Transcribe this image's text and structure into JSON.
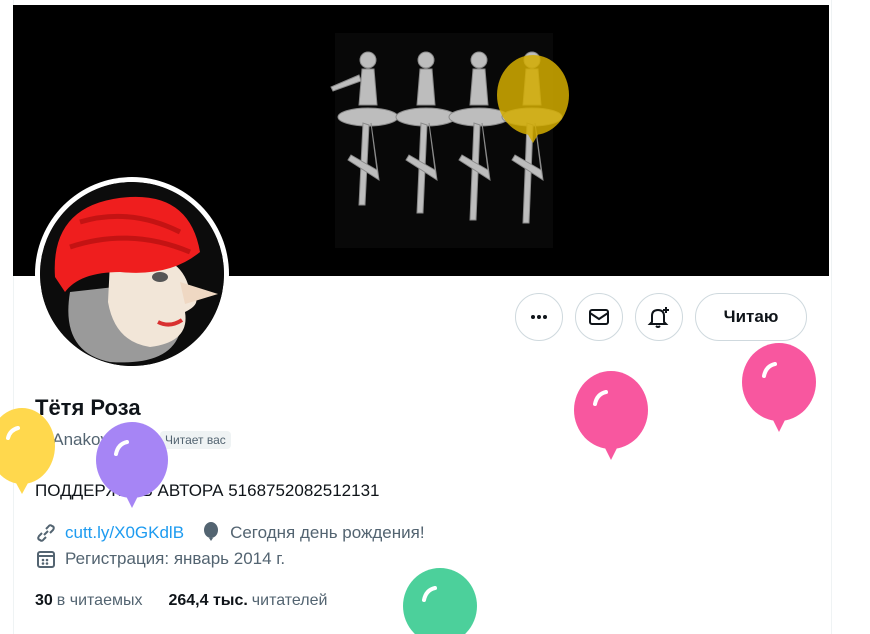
{
  "profile": {
    "display_name": "Тётя Роза",
    "handle": "@Anakoyher",
    "follows_you_badge": "Читает вас",
    "bio": "ПОДДЕРЖАТЬ АВТОРА 5168752082512131",
    "link_text": "cutt.ly/X0GKdlB",
    "birthday_text": "Сегодня день рождения!",
    "joined_text": "Регистрация: январь 2014 г."
  },
  "actions": {
    "follow_label": "Читаю",
    "more_icon": "more-icon",
    "message_icon": "envelope-icon",
    "notify_icon": "bell-plus-icon"
  },
  "stats": {
    "following_count": "30",
    "following_label": "в читаемых",
    "followers_count": "264,4 тыс.",
    "followers_label": "читателей"
  },
  "colors": {
    "link": "#1d9bf0",
    "secondary_text": "#536471",
    "balloon_yellow": "#ffd84d",
    "balloon_gold": "#d4ad00",
    "balloon_purple": "#a685f5",
    "balloon_pink": "#f8579f",
    "balloon_green": "#4cd09b"
  }
}
